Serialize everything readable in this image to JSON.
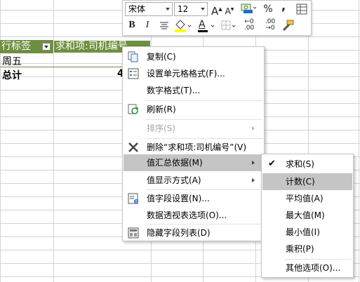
{
  "sheet": {
    "header_row": {
      "col1": "行标签",
      "col2": "求和项:司机编号"
    },
    "rows": [
      {
        "label": "周五"
      },
      {
        "label": "总计",
        "value": "4"
      }
    ]
  },
  "mini_toolbar": {
    "font_name": "宋体",
    "font_size": "12",
    "grow_font": "A",
    "shrink_font": "A",
    "percent": "%",
    "comma": ",",
    "bold": "B",
    "italic": "I",
    "font_color": "A",
    "inc_decimal": ".00",
    "dec_decimal": ".00",
    "inc_decimal_top": "←0",
    "dec_decimal_top": "→0"
  },
  "context_menu": {
    "items": [
      {
        "label": "复制(C)",
        "icon": "copy-icon"
      },
      {
        "label": "设置单元格格式(F)...",
        "icon": "format-cells-icon"
      },
      {
        "label": "数字格式(T)..."
      },
      {
        "label": "刷新(R)",
        "icon": "refresh-icon"
      },
      {
        "label": "排序(S)",
        "disabled": true,
        "submenu": true
      },
      {
        "label": "删除“求和项:司机编号”(V)",
        "icon": "delete-icon"
      },
      {
        "label": "值汇总依据(M)",
        "submenu": true,
        "highlighted": true
      },
      {
        "label": "值显示方式(A)",
        "submenu": true
      },
      {
        "label": "值字段设置(N)...",
        "icon": "field-settings-icon"
      },
      {
        "label": "数据透视表选项(O)..."
      },
      {
        "label": "隐藏字段列表(D)",
        "icon": "field-list-icon"
      }
    ]
  },
  "summarize_submenu": {
    "items": [
      {
        "label": "求和(S)",
        "checked": true
      },
      {
        "label": "计数(C)",
        "highlighted": true
      },
      {
        "label": "平均值(A)"
      },
      {
        "label": "最大值(M)"
      },
      {
        "label": "最小值(I)"
      },
      {
        "label": "乘积(P)"
      },
      {
        "label": "其他选项(O)..."
      }
    ],
    "check_mark": "✔"
  },
  "colors": {
    "pivot_header": "#6e8f3f",
    "menu_highlight": "#c5c5c5",
    "grid": "#d4d4d4"
  }
}
